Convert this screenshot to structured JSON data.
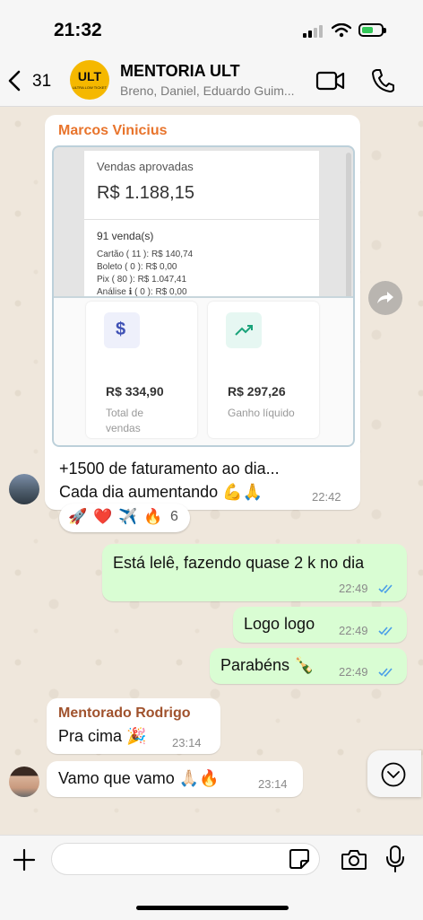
{
  "status_bar": {
    "time": "21:32"
  },
  "header": {
    "back_count": "31",
    "avatar_text": "ULT",
    "avatar_subtext": "ULTRA LOW TICKET",
    "group_name": "MENTORIA ULT",
    "members": "Breno, Daniel, Eduardo Guim..."
  },
  "messages": [
    {
      "sender": "Marcos Vinicius",
      "sender_color": "#e8742c",
      "image": {
        "top_label": "Vendas aprovadas",
        "top_amount": "R$ 1.188,15",
        "count": "91 venda(s)",
        "lines": [
          "Cartão ( 11 ): R$ 140,74",
          "Boleto ( 0 ): R$ 0,00",
          "Pix ( 80 ): R$ 1.047,41",
          "Análise ℹ ( 0 ): R$ 0,00"
        ],
        "card1": {
          "icon": "$",
          "value": "R$ 334,90",
          "caption": "Total de vendas"
        },
        "card2": {
          "icon": "trending-up-icon",
          "value": "R$ 297,26",
          "caption": "Ganho líquido"
        }
      },
      "line1": "+1500 de faturamento ao dia...",
      "line2": "Cada dia aumentando 💪🙏",
      "time": "22:42",
      "reactions": [
        "🚀",
        "❤️",
        "✈️",
        "🔥"
      ],
      "reaction_count": "6"
    },
    {
      "text": "Está lelê, fazendo quase 2 k no dia",
      "time": "22:49"
    },
    {
      "text": "Logo logo",
      "time": "22:49"
    },
    {
      "text": "Parabéns 🍾",
      "time": "22:49"
    },
    {
      "sender": "Mentorado Rodrigo",
      "sender_color": "#a0522d",
      "text": "Pra cima 🎉",
      "time": "23:14"
    },
    {
      "text": "Vamo que vamo 🙏🏻🔥",
      "time": "23:14"
    }
  ],
  "input": {
    "placeholder": ""
  },
  "colors": {
    "outgoing": "#d9fdd3",
    "incoming": "#ffffff",
    "tick_blue": "#4a9ee8"
  }
}
